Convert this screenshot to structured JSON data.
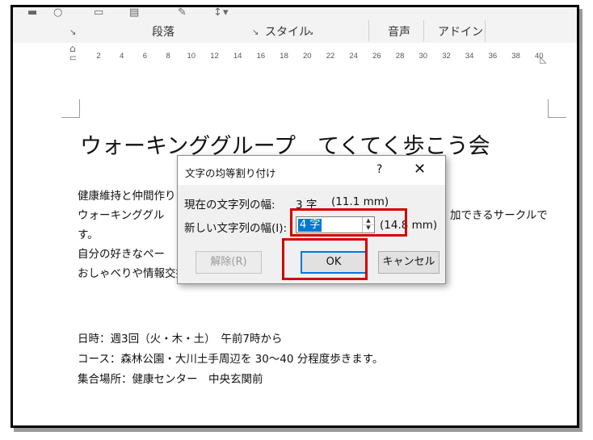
{
  "ribbon": {
    "groups": [
      "段落",
      "スタイル",
      "音声",
      "アドイン"
    ],
    "launcher_glyph": "↘"
  },
  "ruler": {
    "ticks": [
      "2",
      "4",
      "6",
      "8",
      "10",
      "12",
      "14",
      "16",
      "18",
      "20",
      "22",
      "24",
      "26",
      "28",
      "30",
      "32",
      "34",
      "36",
      "38",
      "40"
    ]
  },
  "document": {
    "title": "ウォーキンググループ　てくてく歩こう会",
    "body_lines": [
      "健康維持と仲間作り",
      "ウォーキンググル",
      "す。",
      "自分の好きなペー",
      "おしゃべりや情報交換をしながら、私たちと楽しく歩いてみませんか。"
    ],
    "line2_tail": "加できるサークルで",
    "details": [
      "日時：週3回（火・木・土）　午前7時から",
      "コース：森林公園・大川土手周辺を 30～40 分程度歩きます。",
      "集合場所：健康センター　中央玄関前"
    ]
  },
  "dialog": {
    "title": "文字の均等割り付け",
    "help": "?",
    "close": "✕",
    "current_label": "現在の文字列の幅:",
    "current_value": "3 字",
    "current_mm": "(11.1 mm)",
    "new_label": "新しい文字列の幅(I):",
    "new_value": "4 字",
    "new_mm": "(14.8 mm)",
    "release_button": "解除(R)",
    "ok_button": "OK",
    "cancel_button": "キャンセル"
  },
  "colors": {
    "highlight": "#d20000",
    "selection": "#0078d7"
  }
}
